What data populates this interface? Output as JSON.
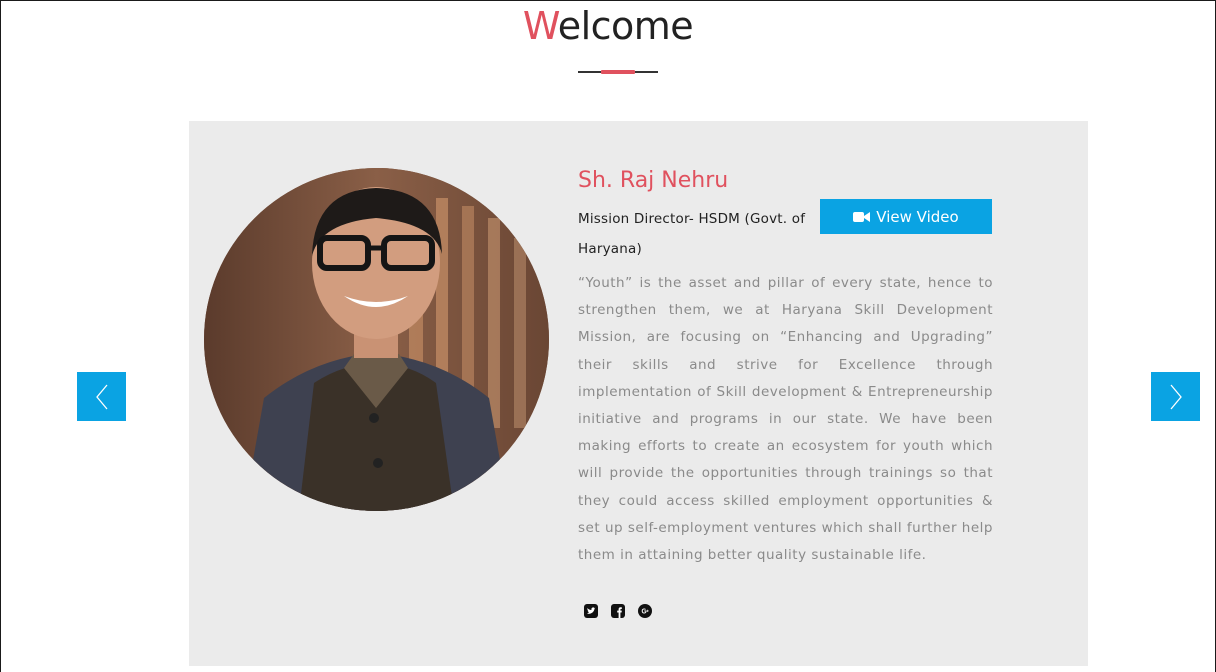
{
  "section": {
    "title_first_letter": "W",
    "title_rest": "elcome"
  },
  "profile": {
    "name": "Sh. Raj Nehru",
    "designation": "Mission Director- HSDM (Govt. of Haryana)",
    "video_button_label": "View Video",
    "quote": "“Youth” is the asset and pillar of every state, hence to strengthen them, we at Haryana Skill Development Mission, are focusing on “Enhancing and Upgrading” their skills and strive for Excellence through implementation of Skill development & Entrepreneurship initiative and programs in our state. We have been making efforts to create an ecosystem for youth which will provide the opportunities through trainings so that they could access skilled employment opportunities & set up self-employment ventures which shall further help them in attaining better quality sustainable life."
  },
  "social_icons": [
    "twitter-icon",
    "facebook-icon",
    "google-plus-icon"
  ],
  "carousel": {
    "prev_icon": "chevron-left-icon",
    "next_icon": "chevron-right-icon"
  },
  "colors": {
    "accent": "#e0515e",
    "button": "#0aa3e3",
    "card_bg": "#ebebeb",
    "quote_text": "#8a8a8a"
  }
}
